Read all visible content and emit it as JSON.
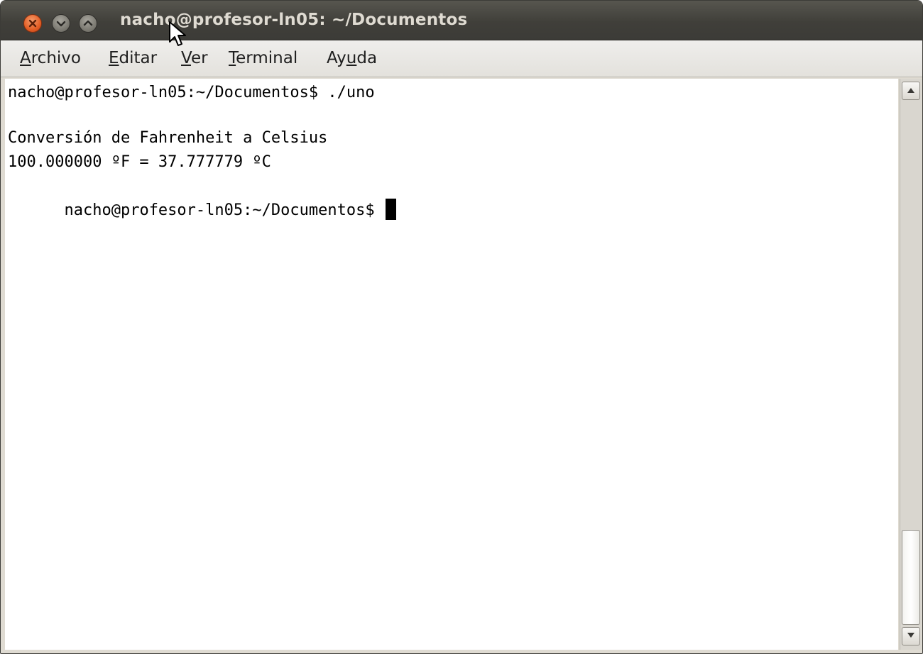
{
  "window": {
    "title": "nacho@profesor-ln05: ~/Documentos",
    "controls": {
      "close_icon": "close-icon",
      "minimize_icon": "minimize-icon",
      "maximize_icon": "maximize-icon"
    }
  },
  "menubar": {
    "items": [
      {
        "label": "Archivo",
        "mnemonic_index": 0
      },
      {
        "label": "Editar",
        "mnemonic_index": 0
      },
      {
        "label": "Ver",
        "mnemonic_index": 0
      },
      {
        "label": "Terminal",
        "mnemonic_index": 0
      },
      {
        "label": "Ayuda",
        "mnemonic_index": 2
      }
    ]
  },
  "terminal": {
    "lines": [
      "nacho@profesor-ln05:~/Documentos$ ./uno",
      "",
      "Conversión de Fahrenheit a Celsius",
      "100.000000 ºF = 37.777779 ºC",
      "nacho@profesor-ln05:~/Documentos$ "
    ],
    "cursor_line": 4
  },
  "scrollbar": {
    "position": 1.0
  },
  "colors": {
    "titlebar": "#3c3b37",
    "title_text": "#dfdbd2",
    "close_button": "#e35d24",
    "terminal_bg": "#ffffff",
    "terminal_fg": "#000000"
  }
}
